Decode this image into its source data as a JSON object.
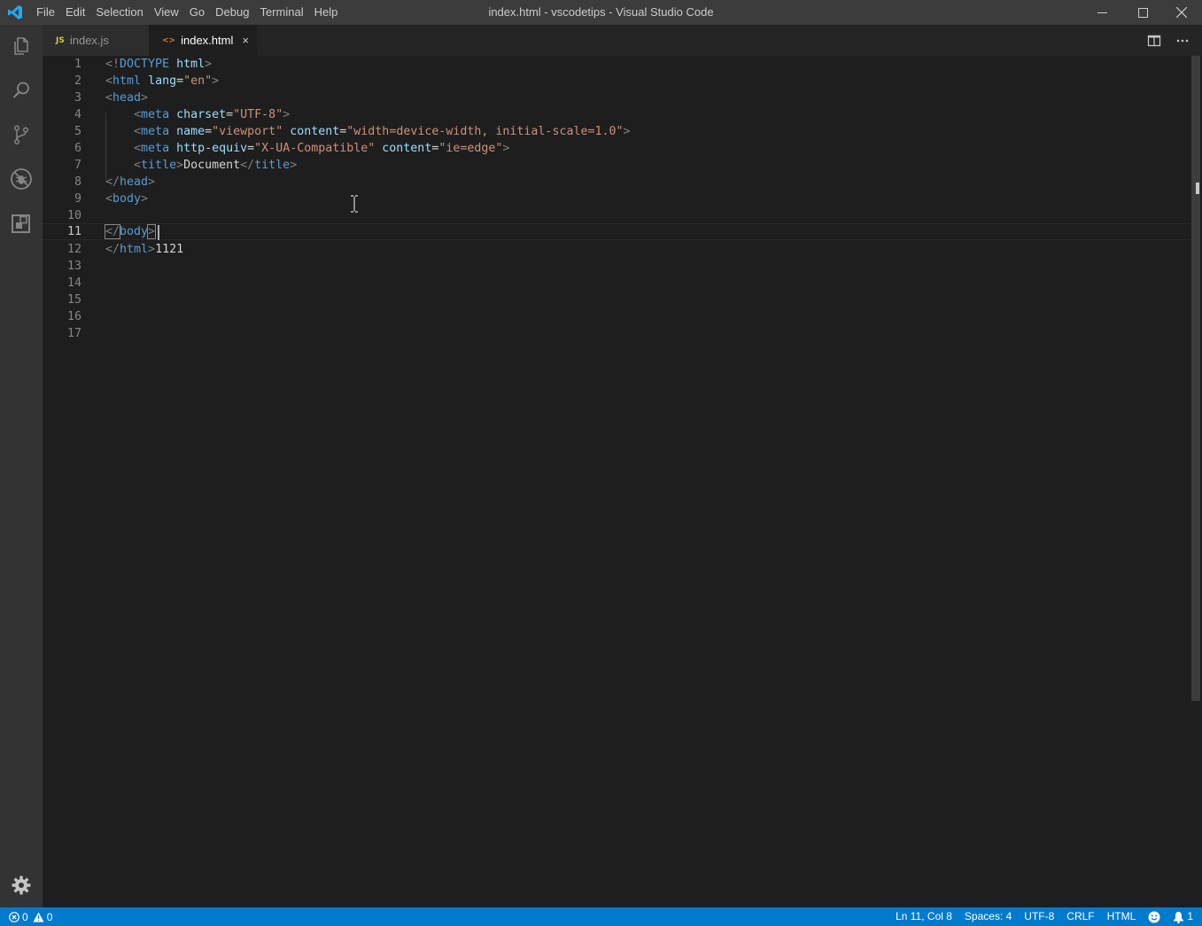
{
  "app": {
    "window_title": "index.html - vscodetips - Visual Studio Code",
    "menu": [
      "File",
      "Edit",
      "Selection",
      "View",
      "Go",
      "Debug",
      "Terminal",
      "Help"
    ]
  },
  "activity_bar": {
    "items": [
      "explorer-icon",
      "search-icon",
      "source-control-icon",
      "debug-icon",
      "extensions-icon"
    ],
    "bottom": "gear-icon"
  },
  "tabs": [
    {
      "icon_text": "JS",
      "label": "index.js",
      "active": false
    },
    {
      "icon_text": "<>",
      "label": "index.html",
      "active": true,
      "close": "×"
    }
  ],
  "editor": {
    "line_numbers": [
      "1",
      "2",
      "3",
      "4",
      "5",
      "6",
      "7",
      "8",
      "9",
      "10",
      "11",
      "12",
      "13",
      "14",
      "15",
      "16",
      "17"
    ],
    "current_line": 11,
    "line1": {
      "a": "<!",
      "b": "DOCTYPE",
      "c": " ",
      "d": "html",
      "e": ">"
    },
    "line2": {
      "a": "<",
      "b": "html",
      "c": " ",
      "d": "lang",
      "e": "=",
      "f": "\"en\"",
      "g": ">"
    },
    "line3": {
      "a": "<",
      "b": "head",
      "c": ">"
    },
    "line4": {
      "indent": "    ",
      "a": "<",
      "b": "meta",
      "c": " ",
      "d": "charset",
      "e": "=",
      "f": "\"UTF-8\"",
      "g": ">"
    },
    "line5": {
      "indent": "    ",
      "a": "<",
      "b": "meta",
      "c": " ",
      "d": "name",
      "e": "=",
      "f": "\"viewport\"",
      "g": " ",
      "h": "content",
      "i": "=",
      "j": "\"width=device-width, initial-scale=1.0\"",
      "k": ">"
    },
    "line6": {
      "indent": "    ",
      "a": "<",
      "b": "meta",
      "c": " ",
      "d": "http-equiv",
      "e": "=",
      "f": "\"X-UA-Compatible\"",
      "g": " ",
      "h": "content",
      "i": "=",
      "j": "\"ie=edge\"",
      "k": ">"
    },
    "line7": {
      "indent": "    ",
      "a": "<",
      "b": "title",
      "c": ">",
      "d": "Document",
      "e": "</",
      "f": "title",
      "g": ">"
    },
    "line8": {
      "a": "</",
      "b": "head",
      "c": ">"
    },
    "line9": {
      "a": "<",
      "b": "body",
      "c": ">"
    },
    "line11": {
      "a": "</",
      "b": "body",
      "c": ">"
    },
    "line12": {
      "a": "</",
      "b": "html",
      "c": ">",
      "d": "1121"
    }
  },
  "status_bar": {
    "errors": "0",
    "warnings": "0",
    "position": "Ln 11, Col 8",
    "spaces": "Spaces: 4",
    "encoding": "UTF-8",
    "eol": "CRLF",
    "language": "HTML",
    "notifications": "1"
  },
  "colors": {
    "accent": "#007acc",
    "tag": "#569cd6",
    "attribute": "#9cdcfe",
    "string": "#ce9178",
    "punctuation": "#808080",
    "text": "#d4d4d4"
  }
}
